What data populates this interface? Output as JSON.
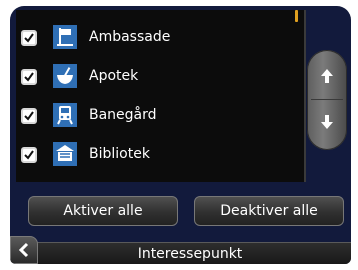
{
  "list": {
    "items": [
      {
        "label": "Ambassade",
        "checked": true,
        "icon": "embassy-flag-icon",
        "icon_bg": "#2f6fb5"
      },
      {
        "label": "Apotek",
        "checked": true,
        "icon": "pharmacy-mortar-icon",
        "icon_bg": "#2f6fb5"
      },
      {
        "label": "Banegård",
        "checked": true,
        "icon": "train-station-icon",
        "icon_bg": "#2f6fb5"
      },
      {
        "label": "Bibliotek",
        "checked": true,
        "icon": "library-building-icon",
        "icon_bg": "#2f6fb5"
      }
    ]
  },
  "buttons": {
    "activate_all": "Aktiver alle",
    "deactivate_all": "Deaktiver alle"
  },
  "footer": {
    "title": "Interessepunkt"
  },
  "colors": {
    "screen_bg": "#121a3c",
    "list_bg": "#0c0c0c",
    "accent": "#e0a020"
  }
}
